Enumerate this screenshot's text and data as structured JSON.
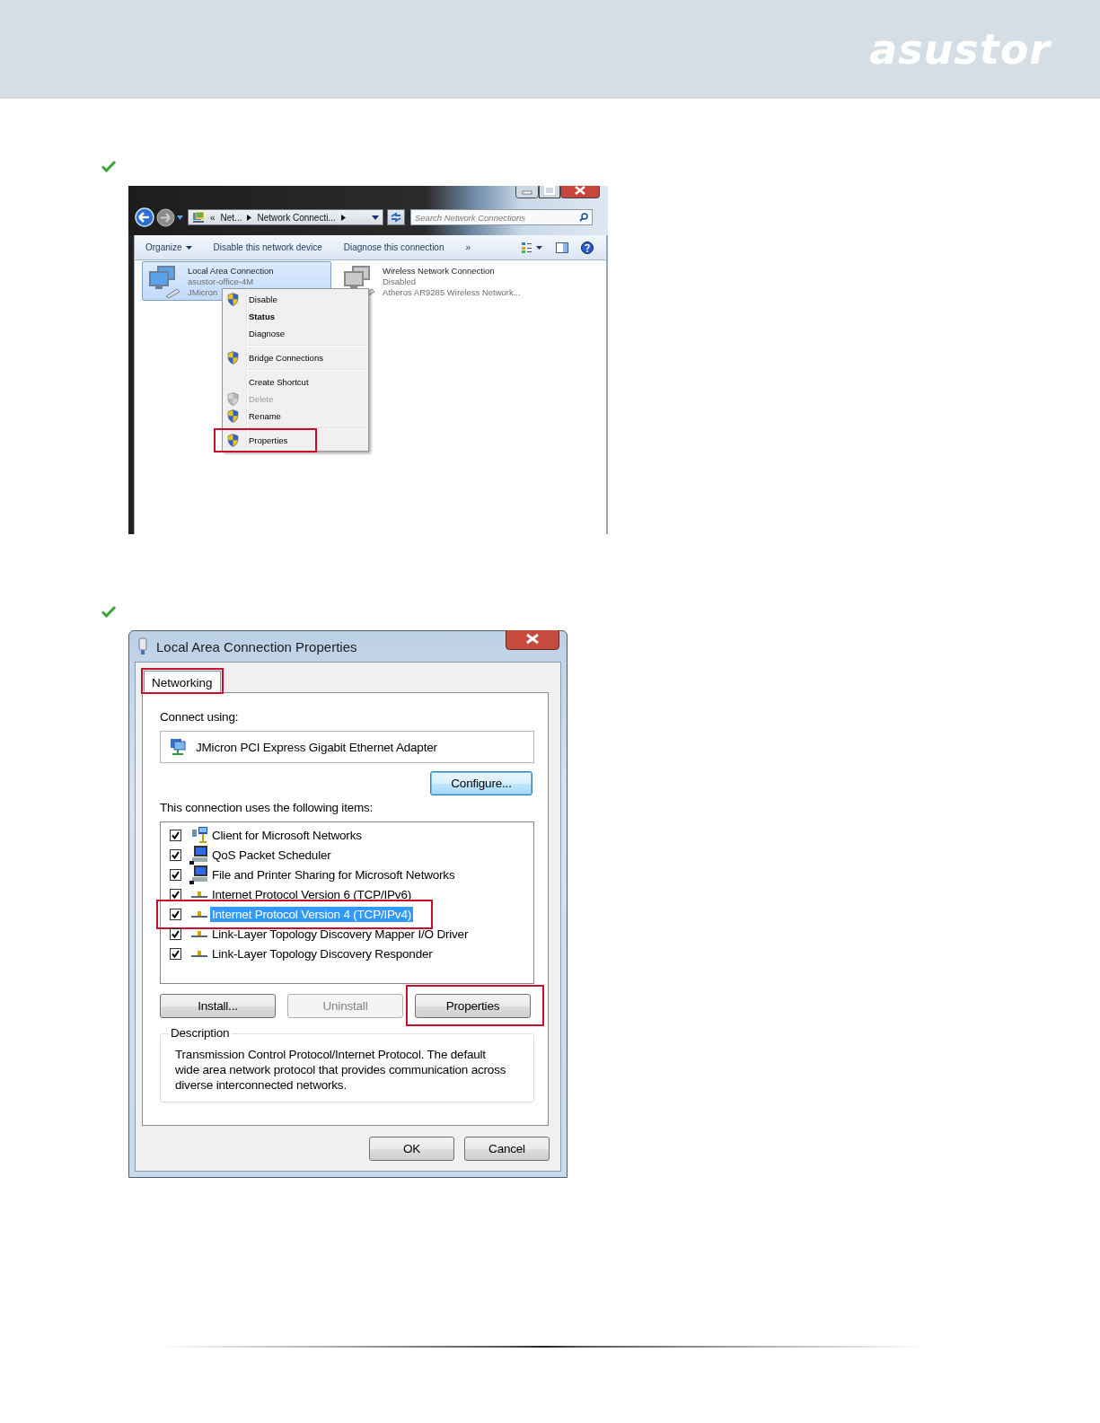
{
  "header": {
    "logo": "asustor"
  },
  "explorer": {
    "address": {
      "overflow": "«",
      "crumbs": [
        "Net...",
        "Network Connecti..."
      ]
    },
    "search": {
      "placeholder": "Search Network Connections"
    },
    "toolbar": {
      "items": [
        {
          "label": "Organize",
          "dropdown": true
        },
        {
          "label": "Disable this network device",
          "dropdown": false
        },
        {
          "label": "Diagnose this connection",
          "dropdown": false
        }
      ],
      "overflow": "»"
    },
    "connections": [
      {
        "name": "Local Area Connection",
        "status": "asustor-office-4M",
        "adapter": "JMicron",
        "selected": true,
        "disabled": false
      },
      {
        "name": "Wireless Network Connection",
        "status": "Disabled",
        "adapter": "Atheros AR9285 Wireless Network...",
        "selected": false,
        "disabled": true
      }
    ],
    "context_menu": [
      {
        "kind": "item",
        "label": "Disable",
        "shield": true,
        "default": false,
        "disabled": false,
        "callout": false
      },
      {
        "kind": "item",
        "label": "Status",
        "shield": false,
        "default": true,
        "disabled": false,
        "callout": false
      },
      {
        "kind": "item",
        "label": "Diagnose",
        "shield": false,
        "default": false,
        "disabled": false,
        "callout": false
      },
      {
        "kind": "separator"
      },
      {
        "kind": "item",
        "label": "Bridge Connections",
        "shield": true,
        "default": false,
        "disabled": false,
        "callout": false
      },
      {
        "kind": "separator"
      },
      {
        "kind": "item",
        "label": "Create Shortcut",
        "shield": false,
        "default": false,
        "disabled": false,
        "callout": false
      },
      {
        "kind": "item",
        "label": "Delete",
        "shield": true,
        "default": false,
        "disabled": true,
        "callout": false
      },
      {
        "kind": "item",
        "label": "Rename",
        "shield": true,
        "default": false,
        "disabled": false,
        "callout": false
      },
      {
        "kind": "separator"
      },
      {
        "kind": "item",
        "label": "Properties",
        "shield": true,
        "default": false,
        "disabled": false,
        "callout": true
      }
    ]
  },
  "dialog": {
    "title": "Local Area Connection Properties",
    "tabs": [
      {
        "label": "Networking",
        "selected": true,
        "callout": true
      }
    ],
    "connect_using_label": "Connect using:",
    "adapter": "JMicron PCI Express Gigabit Ethernet Adapter",
    "configure_button": "Configure...",
    "items_label": "This connection uses the following items:",
    "items": [
      {
        "kind": "client",
        "label": "Client for Microsoft Networks",
        "checked": true,
        "selected": false,
        "callout": false
      },
      {
        "kind": "service",
        "label": "QoS Packet Scheduler",
        "checked": true,
        "selected": false,
        "callout": false
      },
      {
        "kind": "service",
        "label": "File and Printer Sharing for Microsoft Networks",
        "checked": true,
        "selected": false,
        "callout": false
      },
      {
        "kind": "protocol",
        "label": "Internet Protocol Version 6 (TCP/IPv6)",
        "checked": true,
        "selected": false,
        "callout": false
      },
      {
        "kind": "protocol",
        "label": "Internet Protocol Version 4 (TCP/IPv4)",
        "checked": true,
        "selected": true,
        "callout": true
      },
      {
        "kind": "protocol",
        "label": "Link-Layer Topology Discovery Mapper I/O Driver",
        "checked": true,
        "selected": false,
        "callout": false
      },
      {
        "kind": "protocol",
        "label": "Link-Layer Topology Discovery Responder",
        "checked": true,
        "selected": false,
        "callout": false
      }
    ],
    "item_buttons": [
      {
        "label": "Install...",
        "disabled": false,
        "callout": false
      },
      {
        "label": "Uninstall",
        "disabled": true,
        "callout": false
      },
      {
        "label": "Properties",
        "disabled": false,
        "callout": true
      }
    ],
    "description": {
      "legend": "Description",
      "text": "Transmission Control Protocol/Internet Protocol. The default wide area network protocol that provides communication across diverse interconnected networks."
    },
    "footer_buttons": [
      "OK",
      "Cancel"
    ]
  }
}
